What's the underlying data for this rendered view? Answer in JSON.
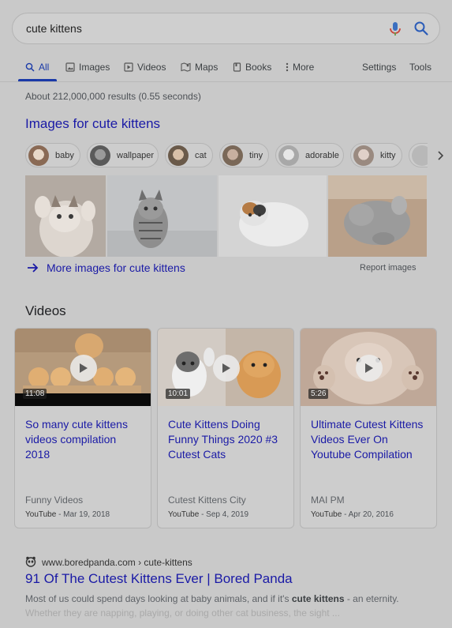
{
  "search": {
    "query": "cute kittens"
  },
  "tabs": [
    {
      "label": "All",
      "icon": "search-icon"
    },
    {
      "label": "Images",
      "icon": "image-icon"
    },
    {
      "label": "Videos",
      "icon": "video-icon"
    },
    {
      "label": "Maps",
      "icon": "map-icon"
    },
    {
      "label": "Books",
      "icon": "book-icon"
    },
    {
      "label": "More",
      "icon": "more-dots-icon"
    },
    {
      "label": "Settings"
    },
    {
      "label": "Tools"
    }
  ],
  "stats": "About 212,000,000 results (0.55 seconds)",
  "images_section": {
    "heading": "Images for cute kittens",
    "chips": [
      "baby",
      "wallpaper",
      "cat",
      "tiny",
      "adorable",
      "kitty"
    ],
    "more_link": "More images for cute kittens",
    "report": "Report images"
  },
  "videos_section": {
    "heading": "Videos",
    "cards": [
      {
        "duration": "11:08",
        "title": "So many cute kittens videos compilation 2018",
        "channel": "Funny Videos",
        "source": "YouTube",
        "date": " - Mar 19, 2018"
      },
      {
        "duration": "10:01",
        "title": "Cute Kittens Doing Funny Things 2020 #3 Cutest Cats",
        "channel": "Cutest Kittens City",
        "source": "YouTube",
        "date": " - Sep 4, 2019"
      },
      {
        "duration": "5:26",
        "title": "Ultimate Cutest Kittens Videos Ever On Youtube Compilation",
        "channel": "MAI PM",
        "source": "YouTube",
        "date": " - Apr 20, 2016"
      }
    ]
  },
  "result": {
    "url": "www.boredpanda.com › cute-kittens",
    "title": "91 Of The Cutest Kittens Ever | Bored Panda",
    "snippet_pre": "Most of us could spend days looking at baby animals, and if it's ",
    "snippet_bold": "cute kittens",
    "snippet_post": " - an eternity.",
    "snippet_line2": "Whether they are napping, playing, or doing other cat business, the sight ..."
  },
  "colors": {
    "link": "#1a1aa6",
    "background": "#c9c9c9",
    "mic_blue": "#3b6fc0",
    "mic_red": "#c8463a"
  }
}
